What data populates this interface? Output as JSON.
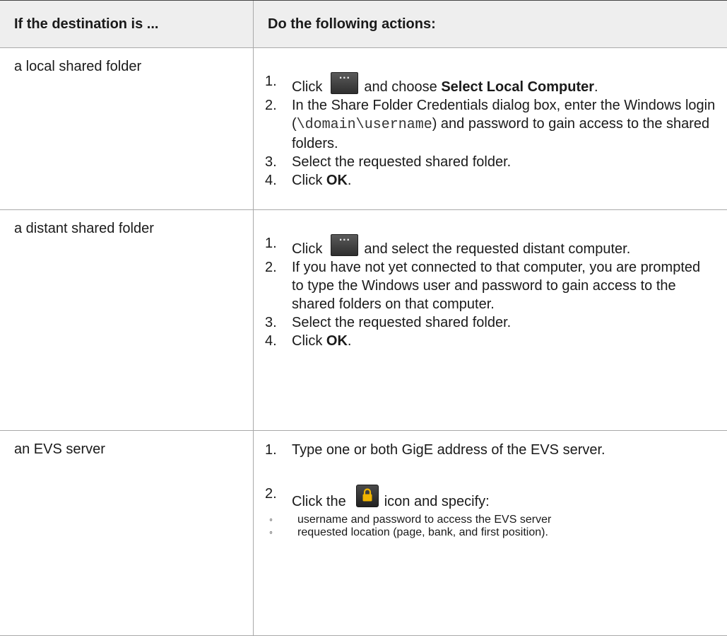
{
  "table": {
    "header_destination": "If the destination is ...",
    "header_actions": "Do the following actions:",
    "rows": [
      {
        "destination": "a local shared folder",
        "steps": [
          {
            "num": "1.",
            "pre": "Click",
            "post": "and choose ",
            "bold": "Select Local Computer",
            "end": "."
          },
          {
            "num": "2.",
            "pre": "In the Share Folder Credentials dialog box, enter the Windows login (",
            "mono": "\\domain\\username",
            "post": ") and password to gain access to the shared folders."
          },
          {
            "num": "3.",
            "text": "Select the requested shared folder."
          },
          {
            "num": "4.",
            "pre": "Click ",
            "bold": "OK",
            "end": "."
          }
        ]
      },
      {
        "destination": "a distant shared folder",
        "steps": [
          {
            "num": "1.",
            "pre": "Click",
            "post": "and select the requested distant computer."
          },
          {
            "num": "2.",
            "text": "If you have not yet connected to that computer, you are prompted to type the Windows user and password to gain access to the shared folders on that computer."
          },
          {
            "num": "3.",
            "text": "Select the requested shared folder."
          },
          {
            "num": "4.",
            "pre": "Click ",
            "bold": "OK",
            "end": "."
          }
        ]
      },
      {
        "destination": "an EVS server",
        "steps": [
          {
            "num": "1.",
            "text": "Type one or both GigE address of the EVS server."
          },
          {
            "num": "2.",
            "pre": "Click the",
            "post": "icon and specify:"
          }
        ],
        "sub_bullets": [
          "username and password to access the EVS server",
          "requested location (page, bank, and first position)."
        ],
        "bullet_glyph": "◦"
      }
    ]
  },
  "icons": {
    "browse_button": "ellipsis-button-icon",
    "lock_button": "lock-icon"
  },
  "colors": {
    "header_bg": "#eeeeee",
    "border": "#a9a9a9",
    "lock_gold": "#f0b400"
  }
}
